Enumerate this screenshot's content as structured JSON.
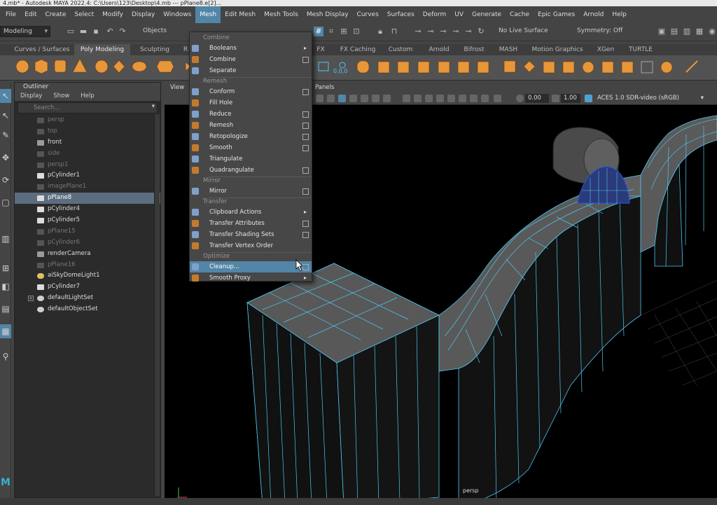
{
  "window_title": "4.mb* - Autodesk MAYA 2022.4: C:\\Users\\123\\Desktop\\4.mb   ---   pPlane8.e[2]...",
  "menubar": [
    "File",
    "Edit",
    "Create",
    "Select",
    "Modify",
    "Display",
    "Windows",
    "Mesh",
    "Edit Mesh",
    "Mesh Tools",
    "Mesh Display",
    "Curves",
    "Surfaces",
    "Deform",
    "UV",
    "Generate",
    "Cache",
    "Epic Games",
    "Arnold",
    "Help"
  ],
  "menubar_active": "Mesh",
  "status": {
    "menuset": "Modeling",
    "objects_label": "Objects",
    "live_surface": "No Live Surface",
    "symmetry": "Symmetry: Off"
  },
  "shelf_tabs": [
    "Curves / Surfaces",
    "Poly Modeling",
    "Sculpting",
    "R",
    "FX",
    "FX Caching",
    "Custom",
    "Arnold",
    "Bifrost",
    "MASH",
    "Motion Graphics",
    "XGen",
    "TURTLE"
  ],
  "shelf_active": "Poly Modeling",
  "shelf_value": "0,0,0",
  "outliner": {
    "title": "Outliner",
    "menu": [
      "Display",
      "Show",
      "Help"
    ],
    "search_placeholder": "Search...",
    "items": [
      {
        "label": "persp",
        "dim": true,
        "icon": "camera"
      },
      {
        "label": "top",
        "dim": true,
        "icon": "camera"
      },
      {
        "label": "front",
        "dim": false,
        "icon": "camera"
      },
      {
        "label": "side",
        "dim": true,
        "icon": "camera"
      },
      {
        "label": "persp1",
        "dim": true,
        "icon": "camera"
      },
      {
        "label": "pCylinder1",
        "dim": false,
        "icon": "mesh"
      },
      {
        "label": "imagePlane1",
        "dim": true,
        "icon": "image"
      },
      {
        "label": "pPlane8",
        "dim": false,
        "icon": "mesh",
        "selected": true
      },
      {
        "label": "pCylinder4",
        "dim": false,
        "icon": "mesh"
      },
      {
        "label": "pCylinder5",
        "dim": false,
        "icon": "mesh"
      },
      {
        "label": "pPlane15",
        "dim": true,
        "icon": "mesh"
      },
      {
        "label": "pCylinder6",
        "dim": true,
        "icon": "mesh"
      },
      {
        "label": "renderCamera",
        "dim": false,
        "icon": "camera"
      },
      {
        "label": "pPlane16",
        "dim": true,
        "icon": "mesh"
      },
      {
        "label": "aiSkyDomeLight1",
        "dim": false,
        "icon": "light"
      },
      {
        "label": "pCylinder7",
        "dim": false,
        "icon": "mesh"
      },
      {
        "label": "defaultLightSet",
        "dim": false,
        "icon": "set",
        "expandable": true
      },
      {
        "label": "defaultObjectSet",
        "dim": false,
        "icon": "set"
      }
    ]
  },
  "viewport": {
    "menu": [
      "View",
      "Panels"
    ],
    "field1": "0.00",
    "field2": "1.00",
    "colorspace": "ACES 1.0 SDR-video (sRGB)",
    "camera_label": "persp"
  },
  "mesh_menu": {
    "sections": [
      {
        "header": "Combine",
        "items": [
          {
            "label": "Booleans",
            "submenu": true
          },
          {
            "label": "Combine",
            "option": true
          },
          {
            "label": "Separate"
          }
        ]
      },
      {
        "header": "Remesh",
        "items": [
          {
            "label": "Conform",
            "option": true
          },
          {
            "label": "Fill Hole"
          },
          {
            "label": "Reduce",
            "option": true
          },
          {
            "label": "Remesh",
            "option": true
          },
          {
            "label": "Retopologize",
            "option": true
          },
          {
            "label": "Smooth",
            "option": true
          },
          {
            "label": "Triangulate"
          },
          {
            "label": "Quadrangulate",
            "option": true
          }
        ]
      },
      {
        "header": "Mirror",
        "items": [
          {
            "label": "Mirror",
            "option": true
          }
        ]
      },
      {
        "header": "Transfer",
        "items": [
          {
            "label": "Clipboard Actions",
            "submenu": true
          },
          {
            "label": "Transfer Attributes",
            "option": true
          },
          {
            "label": "Transfer Shading Sets",
            "option": true
          },
          {
            "label": "Transfer Vertex Order"
          }
        ]
      },
      {
        "header": "Optimize",
        "items": [
          {
            "label": "Cleanup...",
            "option": true,
            "highlighted": true
          },
          {
            "label": "Smooth Proxy",
            "submenu": true
          }
        ]
      }
    ]
  },
  "colors": {
    "accent": "#5285a6",
    "wire": "#4fc6f0",
    "mesh": "#555555",
    "selected_row": "#5c6d80"
  }
}
